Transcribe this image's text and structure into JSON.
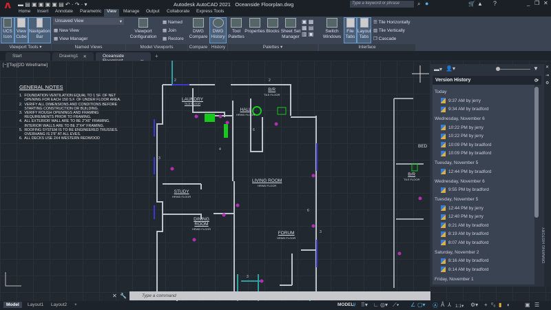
{
  "app": {
    "title": "Autodesk AutoCAD 2021",
    "file": "Oceanside Floorplan.dwg",
    "search_placeholder": "Type a keyword or phrase",
    "accent": "#d2232a"
  },
  "ribbon_tabs": [
    "Home",
    "Insert",
    "Annotate",
    "Parametric",
    "View",
    "Manage",
    "Output",
    "Collaborate",
    "Express Tools"
  ],
  "active_tab": "View",
  "ribbon": {
    "viewport_tools": {
      "label": "Viewport Tools",
      "buttons": [
        "UCS Icon",
        "View Cube",
        "Navigation Bar"
      ]
    },
    "named_views": {
      "label": "Named Views",
      "dropdown": "Unsaved View",
      "items": [
        "New View",
        "View Manager"
      ]
    },
    "model_viewports": {
      "label": "Model Viewports",
      "config": "Viewport Configuration",
      "items": [
        "Named",
        "Join",
        "Restore"
      ]
    },
    "compare": {
      "label": "Compare",
      "button": "DWG Compare"
    },
    "history": {
      "label": "History",
      "button": "DWG History"
    },
    "palettes": {
      "label": "Palettes",
      "buttons": [
        "Tool Palettes",
        "Properties",
        "Blocks",
        "Sheet Set Manager"
      ]
    },
    "interface": {
      "label": "Interface",
      "buttons": [
        "Switch Windows",
        "File Tabs",
        "Layout Tabs"
      ],
      "items": [
        "Tile Horizontally",
        "Tile Vertically",
        "Cascade"
      ]
    }
  },
  "file_tabs": [
    "Start",
    "Drawing1",
    "Oceanside Floorplan*"
  ],
  "viewport_label": "[−][Top][2D Wireframe]",
  "notes": {
    "title": "GENERAL NOTES",
    "lines": [
      "1.  FOUNDATION VENTILATION EQUAL TO 1 SF. OF NET",
      "     OPENING FOR EACH 150 S.F. OF UNDER FLOOR AREA.",
      "2.  VERIFY ALL DIMENSIONS AND CONDITIONS BEFORE",
      "     STARTING CONSTRUCTION OR BUILDING.",
      "3.  VERIFY ROUGH OPENINGS AND FRAMING",
      "     REQUIREMENTS PRIOR TO FRAMING.",
      "4.  ALL EXTERIOR WALL ARE TO BE 2\"X6\" FRAMING.",
      "     INTERIOR WALLS ARE TO BE 2\"X4\" FRAMING.",
      "5.  ROOFING SYSTEM IS TO BE ENGINEERED TRUSSES.",
      "     OVERHANG IS 2'6\" AT ALL EVES.",
      "6.  ALL DECKS USE 2X4 WESTERN REDWOOD"
    ]
  },
  "rooms": [
    {
      "name": "LAUNDRY",
      "floor": "TILE FLOOR"
    },
    {
      "name": "B/R",
      "floor": "TILE FLOOR"
    },
    {
      "name": "HALL",
      "floor": "HRWD FLOOR"
    },
    {
      "name": "LIVING ROOM",
      "floor": "HRWD FLOOR"
    },
    {
      "name": "STUDY",
      "floor": "HRWD FLOOR"
    },
    {
      "name": "DINING ROOM",
      "floor": "HRWD FLOOR"
    },
    {
      "name": "FORUM",
      "floor": "HRWD FLOOR"
    },
    {
      "name": "BED",
      "floor": ""
    },
    {
      "name": "B/R",
      "floor": "TILE FLOOR"
    }
  ],
  "version_history": {
    "title": "Version History",
    "side_label": "DRAWING HISTORY",
    "groups": [
      {
        "date": "Today",
        "items": [
          "9:37 AM by jerry",
          "9:34 AM by bradford"
        ]
      },
      {
        "date": "Wednesday, November 6",
        "items": [
          "10:22 PM by jerry",
          "10:22 PM by jerry",
          "10:09 PM by bradford",
          "10:09 PM by bradford"
        ]
      },
      {
        "date": "Tuesday, November 5",
        "items": [
          "12:44 PM by bradford"
        ]
      },
      {
        "date": "Wednesday, November 6",
        "items": [
          "9:55 PM by bradford"
        ]
      },
      {
        "date": "Tuesday, November 5",
        "items": [
          "12:44 PM by jerry",
          "12:40 PM by jerry",
          "8:21 AM by bradford",
          "8:19 AM by bradford",
          "8:07 AM by bradford"
        ]
      },
      {
        "date": "Saturday, November 2",
        "items": [
          "8:16 AM by bradford",
          "8:14 AM by bradford"
        ]
      },
      {
        "date": "Friday, November 1",
        "items": []
      }
    ]
  },
  "command": {
    "placeholder": "Type a command"
  },
  "layout_tabs": [
    "Model",
    "Layout1",
    "Layout2"
  ],
  "status": {
    "mode": "MODEL",
    "scale": "1:1"
  }
}
